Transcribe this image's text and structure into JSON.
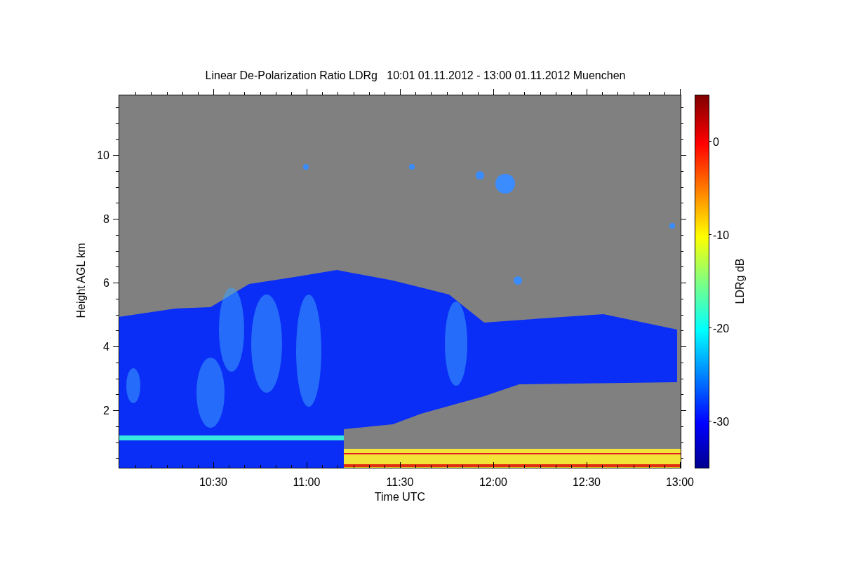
{
  "title": "Linear De-Polarization Ratio LDRg   10:01 01.11.2012 - 13:00 01.11.2012 Muenchen",
  "plot": {
    "xlabel": "Time UTC",
    "ylabel": "Height AGL km",
    "xtick_labels": [
      "10:30",
      "11:00",
      "11:30",
      "12:00",
      "12:30",
      "13:00"
    ],
    "ytick_labels": [
      "10",
      "8",
      "6",
      "4",
      "2"
    ]
  },
  "colorbar": {
    "label": "LDRg dB",
    "tick_labels": [
      "0",
      "-10",
      "-20",
      "-30"
    ]
  }
}
